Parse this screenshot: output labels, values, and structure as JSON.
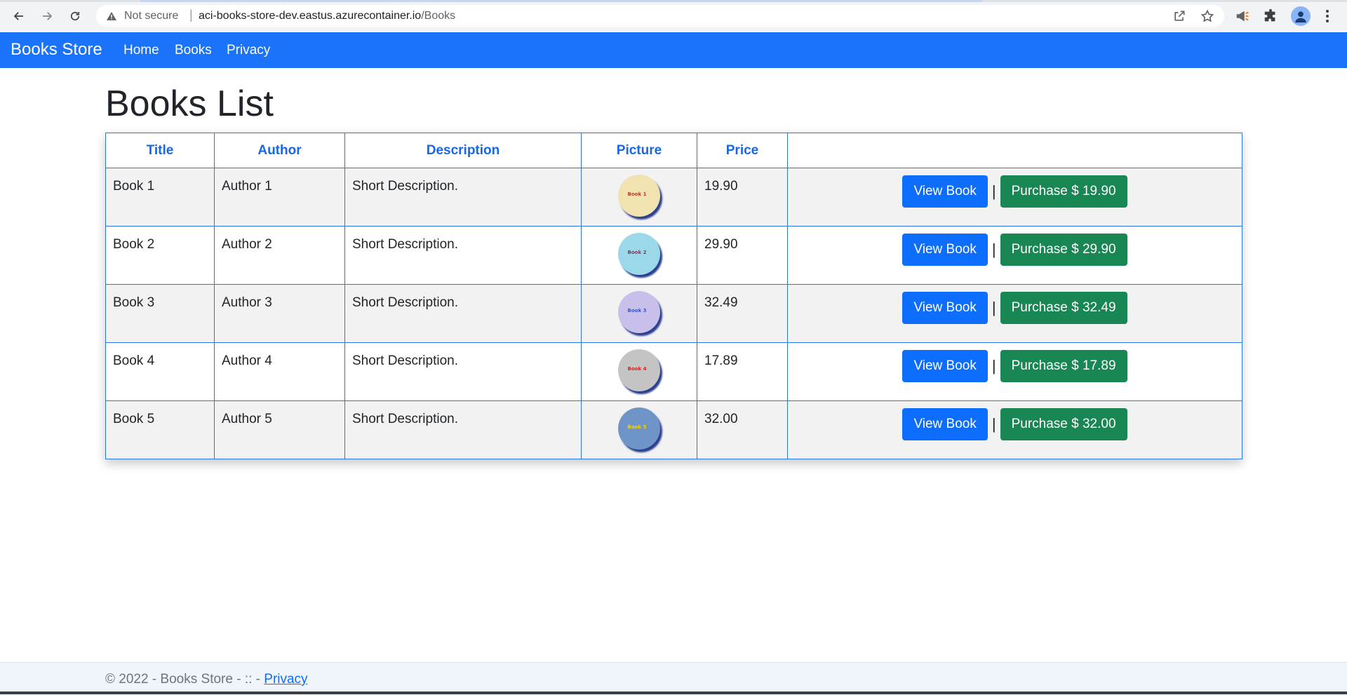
{
  "browser": {
    "security_label": "Not secure",
    "url_host": "aci-books-store-dev.eastus.azurecontainer.io",
    "url_path": "/Books",
    "icons": [
      "back-icon",
      "forward-icon",
      "reload-icon",
      "warning-icon",
      "share-icon",
      "star-icon",
      "extension-megaphone-icon",
      "puzzle-icon",
      "profile-icon",
      "menu-dots-icon"
    ]
  },
  "navbar": {
    "brand": "Books Store",
    "links": [
      "Home",
      "Books",
      "Privacy"
    ],
    "color": "#1a73f8"
  },
  "main": {
    "title": "Books List",
    "table": {
      "headers": [
        "Title",
        "Author",
        "Description",
        "Picture",
        "Price",
        ""
      ],
      "rows": [
        {
          "title": "Book 1",
          "author": "Author 1",
          "description": "Short Description.",
          "pic_label": "Book 1",
          "pic_color": "#f1e3b0",
          "pic_text_color": "#c0392b",
          "price": "19.90",
          "view_label": "View Book",
          "purchase_label": "Purchase $ 19.90"
        },
        {
          "title": "Book 2",
          "author": "Author 2",
          "description": "Short Description.",
          "pic_label": "Book 2",
          "pic_color": "#9bd9ea",
          "pic_text_color": "#7a3b5a",
          "price": "29.90",
          "view_label": "View Book",
          "purchase_label": "Purchase $ 29.90"
        },
        {
          "title": "Book 3",
          "author": "Author 3",
          "description": "Short Description.",
          "pic_label": "Book 3",
          "pic_color": "#c8c0ea",
          "pic_text_color": "#3d57c8",
          "price": "32.49",
          "view_label": "View Book",
          "purchase_label": "Purchase $ 32.49"
        },
        {
          "title": "Book 4",
          "author": "Author 4",
          "description": "Short Description.",
          "pic_label": "Book 4",
          "pic_color": "#c4c4c4",
          "pic_text_color": "#e02020",
          "price": "17.89",
          "view_label": "View Book",
          "purchase_label": "Purchase $ 17.89"
        },
        {
          "title": "Book 5",
          "author": "Author 5",
          "description": "Short Description.",
          "pic_label": "Book 5",
          "pic_color": "#6f94c8",
          "pic_text_color": "#f1d400",
          "price": "32.00",
          "view_label": "View Book",
          "purchase_label": "Purchase $ 32.00"
        }
      ],
      "separator": "|"
    }
  },
  "footer": {
    "text": "© 2022 - Books Store - :: - ",
    "link": "Privacy"
  },
  "colors": {
    "primary_button": "#0d6efd",
    "success_button": "#198754",
    "header_text": "#1a66e8",
    "border": "#2a73e8"
  }
}
